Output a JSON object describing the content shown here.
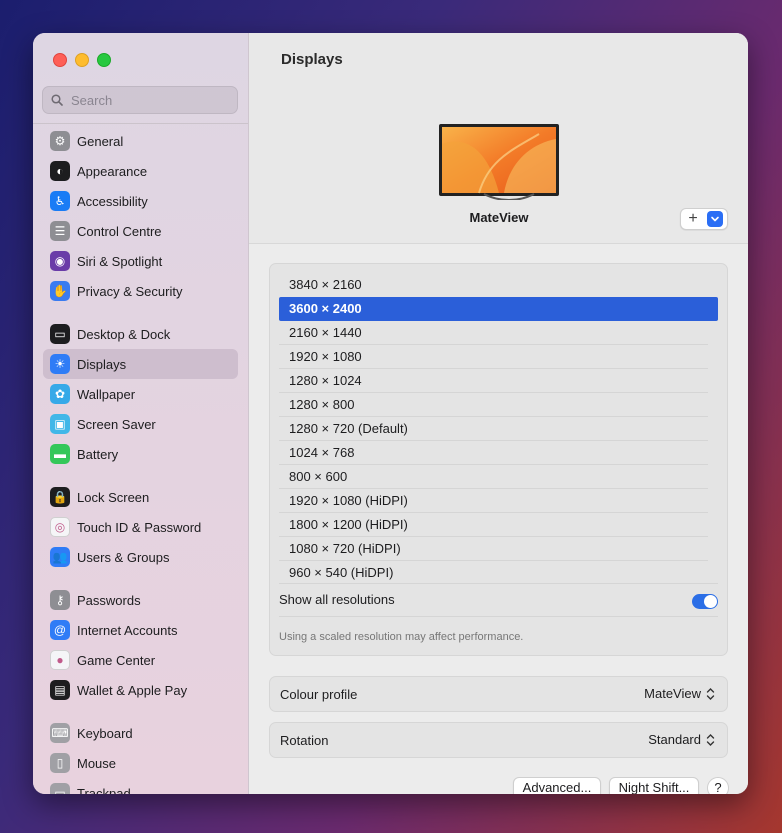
{
  "sidebar": {
    "search_placeholder": "Search",
    "groups": [
      [
        {
          "label": "General",
          "icon": "gear-icon",
          "color": "#8e8e93"
        },
        {
          "label": "Appearance",
          "icon": "appearance-icon",
          "color": "#1d1d1f"
        },
        {
          "label": "Accessibility",
          "icon": "accessibility-icon",
          "color": "#1a7cf5"
        },
        {
          "label": "Control Centre",
          "icon": "control-centre-icon",
          "color": "#8e8e93"
        },
        {
          "label": "Siri & Spotlight",
          "icon": "siri-icon",
          "color": "#6a3ca8"
        },
        {
          "label": "Privacy & Security",
          "icon": "hand-icon",
          "color": "#3a7bf0"
        }
      ],
      [
        {
          "label": "Desktop & Dock",
          "icon": "dock-icon",
          "color": "#1d1d1f"
        },
        {
          "label": "Displays",
          "icon": "sun-icon",
          "color": "#2f7cf6",
          "active": true
        },
        {
          "label": "Wallpaper",
          "icon": "flower-icon",
          "color": "#36a9e8"
        },
        {
          "label": "Screen Saver",
          "icon": "screen-saver-icon",
          "color": "#41b7e8"
        },
        {
          "label": "Battery",
          "icon": "battery-icon",
          "color": "#34c759"
        }
      ],
      [
        {
          "label": "Lock Screen",
          "icon": "lock-icon",
          "color": "#1d1d1f"
        },
        {
          "label": "Touch ID & Password",
          "icon": "fingerprint-icon",
          "color": "#f5f5f7"
        },
        {
          "label": "Users & Groups",
          "icon": "users-icon",
          "color": "#2f7cf6"
        }
      ],
      [
        {
          "label": "Passwords",
          "icon": "key-icon",
          "color": "#8e8e93"
        },
        {
          "label": "Internet Accounts",
          "icon": "at-icon",
          "color": "#2f7cf6"
        },
        {
          "label": "Game Center",
          "icon": "game-center-icon",
          "color": "#f5f5f7"
        },
        {
          "label": "Wallet & Apple Pay",
          "icon": "wallet-icon",
          "color": "#1d1d1f"
        }
      ],
      [
        {
          "label": "Keyboard",
          "icon": "keyboard-icon",
          "color": "#a0a0a5"
        },
        {
          "label": "Mouse",
          "icon": "mouse-icon",
          "color": "#a0a0a5"
        },
        {
          "label": "Trackpad",
          "icon": "trackpad-icon",
          "color": "#a0a0a5"
        }
      ]
    ]
  },
  "main": {
    "title": "Displays",
    "monitor_name": "MateView",
    "add_label": "+",
    "resolutions": [
      "3840 × 2160",
      "3600 × 2400",
      "2160 × 1440",
      "1920 × 1080",
      "1280 × 1024",
      "1280 × 800",
      "1280 × 720 (Default)",
      "1024 × 768",
      "800 × 600",
      "1920 × 1080 (HiDPI)",
      "1800 × 1200 (HiDPI)",
      "1080 × 720 (HiDPI)",
      "960 × 540 (HiDPI)"
    ],
    "selected_resolution_index": 1,
    "show_all_label": "Show all resolutions",
    "show_all_on": true,
    "note": "Using a scaled resolution may affect performance.",
    "colour_profile_label": "Colour profile",
    "colour_profile_value": "MateView",
    "rotation_label": "Rotation",
    "rotation_value": "Standard",
    "advanced_label": "Advanced...",
    "night_shift_label": "Night Shift...",
    "help_label": "?"
  },
  "colors": {
    "accent": "#2b5fd9",
    "toggle": "#2b6ee6"
  }
}
